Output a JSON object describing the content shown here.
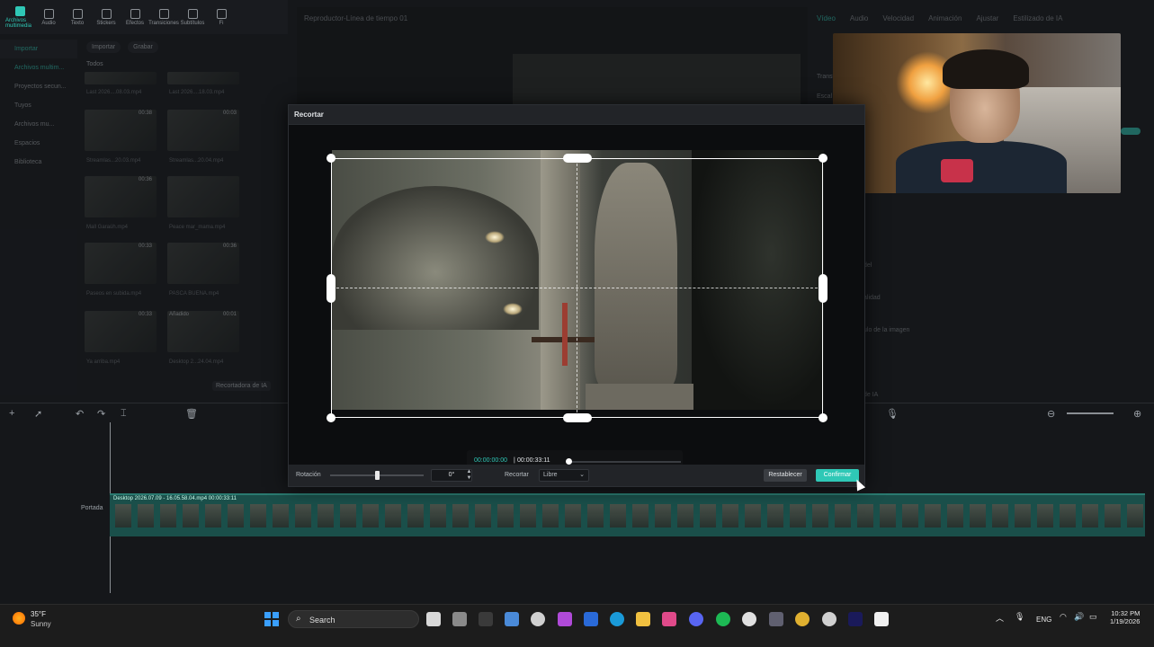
{
  "toolbar": {
    "items": [
      {
        "label": "Archivos multimedia",
        "icon": "media-icon",
        "active": true
      },
      {
        "label": "Audio",
        "icon": "audio-icon"
      },
      {
        "label": "Texto",
        "icon": "text-icon"
      },
      {
        "label": "Stickers",
        "icon": "sticker-icon"
      },
      {
        "label": "Efectos",
        "icon": "effects-icon"
      },
      {
        "label": "Transiciones",
        "icon": "transitions-icon"
      },
      {
        "label": "Subtítulos",
        "icon": "subtitles-icon"
      },
      {
        "label": "Fi",
        "icon": "filter-icon"
      }
    ]
  },
  "sidebar": {
    "items": [
      {
        "label": "Importar",
        "active": true
      },
      {
        "label": "Archivos multim..."
      },
      {
        "label": "Proyectos secun..."
      },
      {
        "label": "Tuyos"
      },
      {
        "label": "Archivos mu..."
      },
      {
        "label": "Espacios"
      },
      {
        "label": "Biblioteca"
      }
    ]
  },
  "media": {
    "import_label": "Importar",
    "record_label": "Grabar",
    "filter_label": "Todos",
    "cutout_label": "Recortadora de IA",
    "thumbs": [
      {
        "caption": "Last 2026....08.03.mp4",
        "duration": ""
      },
      {
        "caption": "Last 2026....18.03.mp4",
        "duration": ""
      },
      {
        "caption": "Streamlas...20.03.mp4",
        "duration": "00:38"
      },
      {
        "caption": "Streamlas...20.04.mp4",
        "duration": "00:03"
      },
      {
        "caption": "Mall Garaúh.mp4",
        "duration": "00:36"
      },
      {
        "caption": "Peace mar_mama.mp4",
        "duration": ""
      },
      {
        "caption": "Paseos en subida.mp4",
        "duration": "00:33"
      },
      {
        "caption": "PASCA BUENA.mp4",
        "duration": "00:36"
      },
      {
        "caption": "Ya arriba.mp4",
        "duration": "00:33"
      },
      {
        "caption": "Desktop 2...24.04.mp4",
        "duration": "00:01",
        "badge": "Añadido"
      }
    ]
  },
  "player": {
    "title": "Reproductor-Línea de tiempo 01"
  },
  "right_panel": {
    "tabs": [
      "Vídeo",
      "Audio",
      "Velocidad",
      "Animación",
      "Ajustar",
      "Estilizado de IA"
    ],
    "active_tab": "Vídeo",
    "labels": [
      "Transf",
      "Escal",
      "del",
      "alidad",
      "ulo de la imagen",
      "de IA"
    ]
  },
  "modal": {
    "title": "Recortar",
    "time_current": "00:00:00:00",
    "time_separator": "|",
    "time_total": "00:00:33:11",
    "playhead_fraction": 0.0,
    "rotation_label": "Rotación",
    "rotation_value": "0°",
    "rotation_fraction": 0.5,
    "crop_label": "Recortar",
    "crop_ratio": "Libre",
    "reset_label": "Restablecer",
    "confirm_label": "Confirmar"
  },
  "timeline": {
    "clip_label": "Desktop 2026.07.09 - 16.05.58.04.mp4   00:00:33:11",
    "cover_label": "Portada"
  },
  "taskbar": {
    "weather_temp": "35°F",
    "weather_cond": "Sunny",
    "search_label": "Search",
    "lang": "ENG",
    "time": "10:32 PM",
    "date": "1/19/2026"
  },
  "colors": {
    "accent": "#2fc8b6",
    "bg": "#15171a"
  }
}
